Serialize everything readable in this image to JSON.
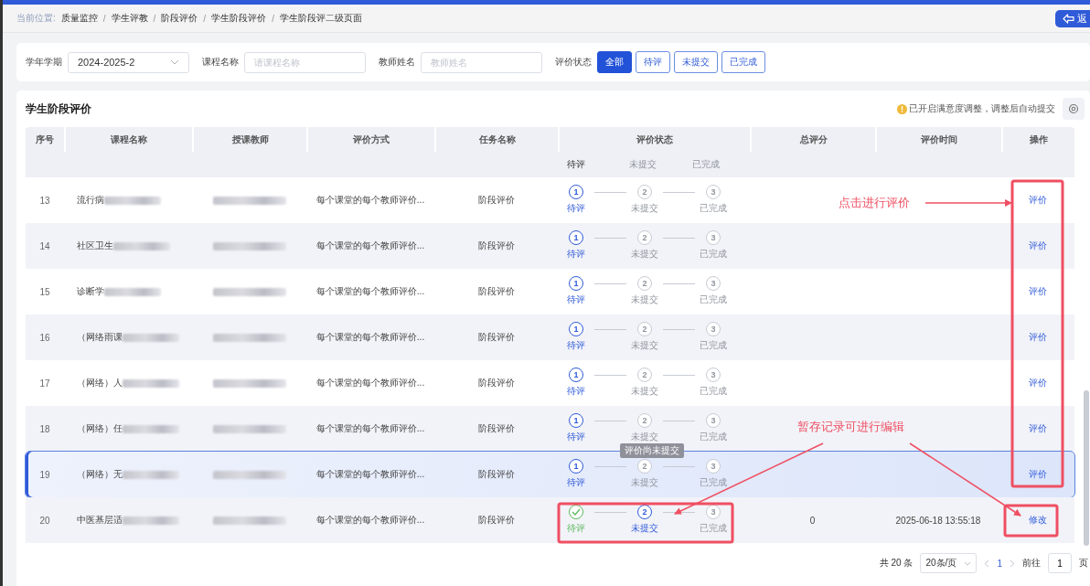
{
  "breadcrumb": {
    "label": "当前位置:",
    "separator": "/",
    "items": [
      "质量监控",
      "学生评教",
      "阶段评价",
      "学生阶段评价",
      "学生阶段评二级页面"
    ]
  },
  "back_button": {
    "label": "返"
  },
  "filters": {
    "term": {
      "label": "学年学期",
      "value": "2024-2025-2"
    },
    "course": {
      "label": "课程名称",
      "placeholder": "请课程名称"
    },
    "teacher": {
      "label": "教师姓名",
      "placeholder": "教师姓名"
    },
    "status": {
      "label": "评价状态",
      "options": [
        {
          "label": "全部",
          "selected": true
        },
        {
          "label": "待评",
          "selected": false
        },
        {
          "label": "未提交",
          "selected": false
        },
        {
          "label": "已完成",
          "selected": false
        }
      ]
    }
  },
  "table": {
    "title": "学生阶段评价",
    "notice": "已开启满意度调整，调整后自动提交",
    "columns": [
      "序号",
      "课程名称",
      "授课教师",
      "评价方式",
      "任务名称",
      "评价状态",
      "总评分",
      "评价时间",
      "操作"
    ],
    "partial_row": {
      "steps": [
        {
          "label": "待评",
          "active": true,
          "done": false
        },
        {
          "label": "未提交",
          "active": false,
          "done": false
        },
        {
          "label": "已完成",
          "active": false,
          "done": false
        }
      ]
    },
    "rows": [
      {
        "no": "13",
        "course": "流行病",
        "method": "每个课堂的每个教师评价...",
        "task": "阶段评价",
        "selected": false,
        "steps": [
          {
            "number": "1",
            "label": "待评",
            "active": true,
            "done": false
          },
          {
            "number": "2",
            "label": "未提交",
            "active": false,
            "done": false
          },
          {
            "number": "3",
            "label": "已完成",
            "active": false,
            "done": false
          }
        ],
        "action": "评价"
      },
      {
        "no": "14",
        "course": "社区卫生",
        "method": "每个课堂的每个教师评价...",
        "task": "阶段评价",
        "selected": false,
        "steps": [
          {
            "number": "1",
            "label": "待评",
            "active": true,
            "done": false
          },
          {
            "number": "2",
            "label": "未提交",
            "active": false,
            "done": false
          },
          {
            "number": "3",
            "label": "已完成",
            "active": false,
            "done": false
          }
        ],
        "action": "评价"
      },
      {
        "no": "15",
        "course": "诊断学",
        "method": "每个课堂的每个教师评价...",
        "task": "阶段评价",
        "selected": false,
        "steps": [
          {
            "number": "1",
            "label": "待评",
            "active": true,
            "done": false
          },
          {
            "number": "2",
            "label": "未提交",
            "active": false,
            "done": false
          },
          {
            "number": "3",
            "label": "已完成",
            "active": false,
            "done": false
          }
        ],
        "action": "评价"
      },
      {
        "no": "16",
        "course": "（网络雨课",
        "method": "每个课堂的每个教师评价...",
        "task": "阶段评价",
        "selected": false,
        "steps": [
          {
            "number": "1",
            "label": "待评",
            "active": true,
            "done": false
          },
          {
            "number": "2",
            "label": "未提交",
            "active": false,
            "done": false
          },
          {
            "number": "3",
            "label": "已完成",
            "active": false,
            "done": false
          }
        ],
        "action": "评价"
      },
      {
        "no": "17",
        "course": "（网络）人",
        "method": "每个课堂的每个教师评价...",
        "task": "阶段评价",
        "selected": false,
        "steps": [
          {
            "number": "1",
            "label": "待评",
            "active": true,
            "done": false
          },
          {
            "number": "2",
            "label": "未提交",
            "active": false,
            "done": false
          },
          {
            "number": "3",
            "label": "已完成",
            "active": false,
            "done": false
          }
        ],
        "action": "评价"
      },
      {
        "no": "18",
        "course": "（网络）任",
        "method": "每个课堂的每个教师评价...",
        "task": "阶段评价",
        "selected": false,
        "steps": [
          {
            "number": "1",
            "label": "待评",
            "active": true,
            "done": false
          },
          {
            "number": "2",
            "label": "未提交",
            "active": false,
            "done": false
          },
          {
            "number": "3",
            "label": "已完成",
            "active": false,
            "done": false
          }
        ],
        "action": "评价"
      },
      {
        "no": "19",
        "course": "（网络）无",
        "method": "每个课堂的每个教师评价...",
        "task": "阶段评价",
        "selected": true,
        "tooltip": "评价尚未提交",
        "steps": [
          {
            "number": "1",
            "label": "待评",
            "active": true,
            "done": false
          },
          {
            "number": "2",
            "label": "未提交",
            "active": false,
            "done": false
          },
          {
            "number": "3",
            "label": "已完成",
            "active": false,
            "done": false
          }
        ],
        "action": "评价"
      },
      {
        "no": "20",
        "course": "中医基层适",
        "method": "每个课堂的每个教师评价...",
        "task": "阶段评价",
        "selected": false,
        "steps": [
          {
            "label": "待评",
            "active": false,
            "done": true
          },
          {
            "number": "2",
            "label": "未提交",
            "active": true,
            "done": false
          },
          {
            "number": "3",
            "label": "已完成",
            "active": false,
            "done": false
          }
        ],
        "score": "0",
        "time": "2025-06-18 13:55:18",
        "action": "修改"
      }
    ]
  },
  "pagination": {
    "total": "共 20 条",
    "page_size": "20条/页",
    "current_page": "1",
    "goto_label": "前往",
    "goto_value": "1",
    "page_suffix": "页"
  },
  "annotations": [
    {
      "text": "点击进行评价"
    },
    {
      "text": "暂存记录可进行编辑"
    }
  ]
}
